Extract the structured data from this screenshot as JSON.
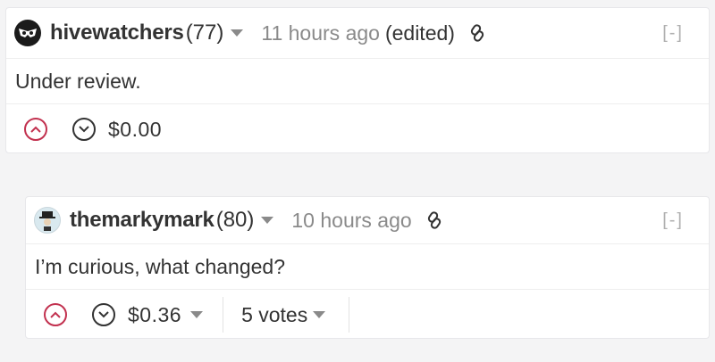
{
  "comments": [
    {
      "author": "hivewatchers",
      "reputation": "(77)",
      "time": "11 hours ago",
      "edited": "(edited)",
      "collapse": "[-]",
      "body": "Under review.",
      "payout": "$0.00",
      "avatar_icon": "owl-mask-icon"
    },
    {
      "author": "themarkymark",
      "reputation": "(80)",
      "time": "10 hours ago",
      "collapse": "[-]",
      "body": "I’m curious, what changed?",
      "payout": "$0.36",
      "votes": "5 votes",
      "avatar_icon": "hat-man-icon"
    }
  ],
  "colors": {
    "upvote": "#c2314f",
    "muted": "#8a8a8a",
    "text": "#333333"
  }
}
